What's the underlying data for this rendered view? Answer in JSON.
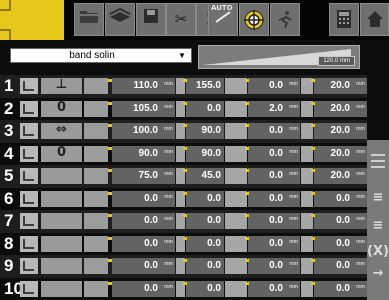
{
  "toolbar": {
    "auto_label": "AUTO",
    "buttons": [
      {
        "name": "folder-icon",
        "glyph": ""
      },
      {
        "name": "layers-icon",
        "glyph": ""
      },
      {
        "name": "save-icon",
        "glyph": ""
      },
      {
        "name": "tools-icon",
        "glyph": "✂"
      },
      {
        "name": "count-icon",
        "glyph": "1"
      },
      {
        "name": "auto-icon",
        "glyph": ""
      },
      {
        "name": "target-icon",
        "glyph": ""
      },
      {
        "name": "runner-icon",
        "glyph": "🏃"
      },
      {
        "name": "calculator-icon",
        "glyph": ""
      },
      {
        "name": "home-icon",
        "glyph": ""
      }
    ]
  },
  "program_select": {
    "value": "band solin"
  },
  "preview": {
    "length_label": "120.0 mm"
  },
  "unit": "mm",
  "rows": [
    {
      "num": "1",
      "tool": "⊥",
      "v1": "110.0",
      "v2": "155.0",
      "v3": "0.0",
      "v4": "20.0"
    },
    {
      "num": "2",
      "tool": "0",
      "v1": "105.0",
      "v2": "0.0",
      "v3": "2.0",
      "v4": "20.0"
    },
    {
      "num": "3",
      "tool": "⇔",
      "v1": "100.0",
      "v2": "90.0",
      "v3": "0.0",
      "v4": "20.0"
    },
    {
      "num": "4",
      "tool": "0",
      "v1": "90.0",
      "v2": "90.0",
      "v3": "0.0",
      "v4": "20.0"
    },
    {
      "num": "5",
      "tool": "",
      "v1": "75.0",
      "v2": "45.0",
      "v3": "0.0",
      "v4": "20.0"
    },
    {
      "num": "6",
      "tool": "",
      "v1": "0.0",
      "v2": "0.0",
      "v3": "0.0",
      "v4": "0.0"
    },
    {
      "num": "7",
      "tool": "",
      "v1": "0.0",
      "v2": "0.0",
      "v3": "0.0",
      "v4": "0.0"
    },
    {
      "num": "8",
      "tool": "",
      "v1": "0.0",
      "v2": "0.0",
      "v3": "0.0",
      "v4": "0.0"
    },
    {
      "num": "9",
      "tool": "",
      "v1": "0.0",
      "v2": "0.0",
      "v3": "0.0",
      "v4": "0.0"
    },
    {
      "num": "10",
      "tool": "",
      "v1": "0.0",
      "v2": "0.0",
      "v3": "0.0",
      "v4": "0.0"
    }
  ],
  "side_panel": {
    "symbols": [
      "≡",
      "≡",
      "(X)",
      "→"
    ]
  },
  "colors": {
    "brand_yellow": "#e6c81b",
    "marker_yellow": "#f0c420",
    "cell_gray": "#636363"
  }
}
